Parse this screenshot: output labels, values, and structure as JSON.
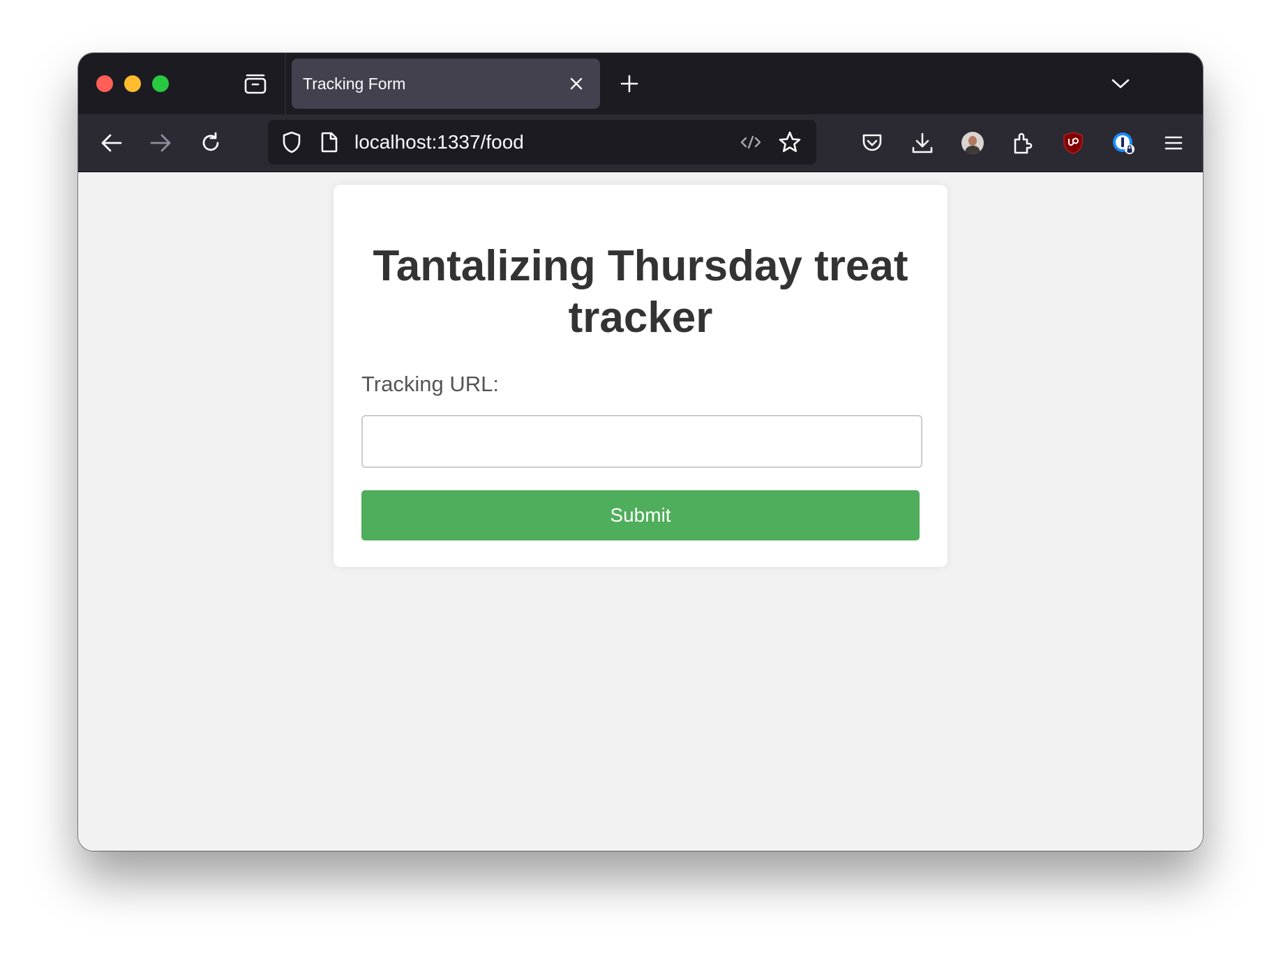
{
  "browser": {
    "tab": {
      "title": "Tracking Form"
    },
    "url": "localhost:1337/food",
    "icons": {
      "tabs_view": "tab-overview-icon",
      "tab_close": "close-icon",
      "new_tab": "plus-icon",
      "list_all_tabs": "chevron-down-icon",
      "back": "arrow-left-icon",
      "forward": "arrow-right-icon",
      "reload": "reload-icon",
      "tracking_protection": "shield-icon",
      "page_info": "document-icon",
      "reader_view": "code-icon",
      "bookmark": "star-icon",
      "pocket": "pocket-icon",
      "downloads": "download-icon",
      "account": "avatar",
      "extensions": "puzzle-icon",
      "ublock": "ublock-origin-icon",
      "onepassword": "1password-icon",
      "menu": "hamburger-menu-icon"
    },
    "colors": {
      "tabbar_bg": "#1c1b22",
      "navbar_bg": "#2b2a33",
      "active_tab_bg": "#42414d",
      "close": "#ff5f57",
      "minimize": "#febc2e",
      "maximize": "#28c840"
    }
  },
  "page": {
    "heading": "Tantalizing Thursday treat tracker",
    "form": {
      "label": "Tracking URL:",
      "input_value": "",
      "input_placeholder": "",
      "submit_label": "Submit"
    },
    "colors": {
      "background": "#f2f2f2",
      "card": "#ffffff",
      "button": "#4fae5b",
      "heading_text": "#333333"
    }
  }
}
